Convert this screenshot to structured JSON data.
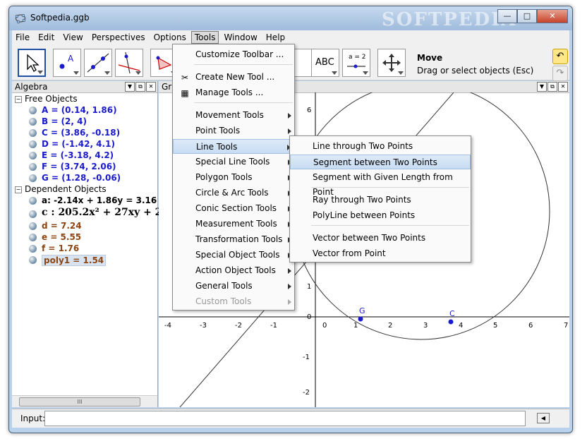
{
  "window": {
    "title": "Softpedia.ggb",
    "watermark": "SOFTPEDIA"
  },
  "menubar": [
    "File",
    "Edit",
    "View",
    "Perspectives",
    "Options",
    "Tools",
    "Window",
    "Help"
  ],
  "toolbar": {
    "help_title": "Move",
    "help_text": "Drag or select objects (Esc)",
    "tools": [
      "move-tool",
      "point-tool",
      "line-tool",
      "perpendicular-tool",
      "polygon-tool",
      "text-tool",
      "slider-tool",
      "move-graphics-tool"
    ],
    "text_tool_label": "ABC",
    "slider_tool_label": "a = 2"
  },
  "algebra": {
    "title": "Algebra",
    "free_label": "Free Objects",
    "dependent_label": "Dependent Objects",
    "free": [
      "A = (0.14, 1.86)",
      "B = (2, 4)",
      "C = (3.86, -0.18)",
      "D = (-1.42, 4.1)",
      "E = (-3.18, 4.2)",
      "F = (3.74, 2.06)",
      "G = (1.28, -0.06)"
    ],
    "dependent": [
      {
        "text": "a: -2.14x + 1.86y = 3.16",
        "color": "#000000"
      },
      {
        "text": "c : 205.2x² + 27xy + 202",
        "color": "#000000"
      },
      {
        "text": "d = 7.24",
        "color": "#8b4513"
      },
      {
        "text": "e = 5.55",
        "color": "#8b4513"
      },
      {
        "text": "f = 1.76",
        "color": "#8b4513"
      },
      {
        "text": "poly1 = 1.54",
        "color": "#8b4513"
      }
    ],
    "scroll_thumb": "III"
  },
  "graphics": {
    "title": "Gra",
    "x_ticks": [
      "-4",
      "-3",
      "-2",
      "-1",
      "0",
      "1",
      "2",
      "3",
      "4",
      "5",
      "6",
      "7"
    ],
    "y_ticks": [
      "6",
      "1",
      "0",
      "-1",
      "-2"
    ],
    "point_G": "G",
    "point_C": "C"
  },
  "tools_menu": {
    "items": [
      "Customize Toolbar ...",
      "Create New Tool ...",
      "Manage Tools ...",
      "Movement Tools",
      "Point Tools",
      "Line Tools",
      "Special Line Tools",
      "Polygon Tools",
      "Circle & Arc Tools",
      "Conic Section Tools",
      "Measurement Tools",
      "Transformation Tools",
      "Special Object Tools",
      "Action Object Tools",
      "General Tools",
      "Custom Tools"
    ]
  },
  "line_tools_submenu": {
    "items": [
      "Line through Two Points",
      "Segment between Two Points",
      "Segment with Given Length from Point",
      "Ray through Two Points",
      "PolyLine between Points",
      "Vector between Two Points",
      "Vector from Point"
    ]
  },
  "input_bar": {
    "label": "Input:",
    "value": ""
  },
  "colors": {
    "accent": "#1f4fa5",
    "menu_highlight": "#c7dcf3",
    "dependent_value": "#8b4513",
    "free_object": "#1a1acc"
  }
}
